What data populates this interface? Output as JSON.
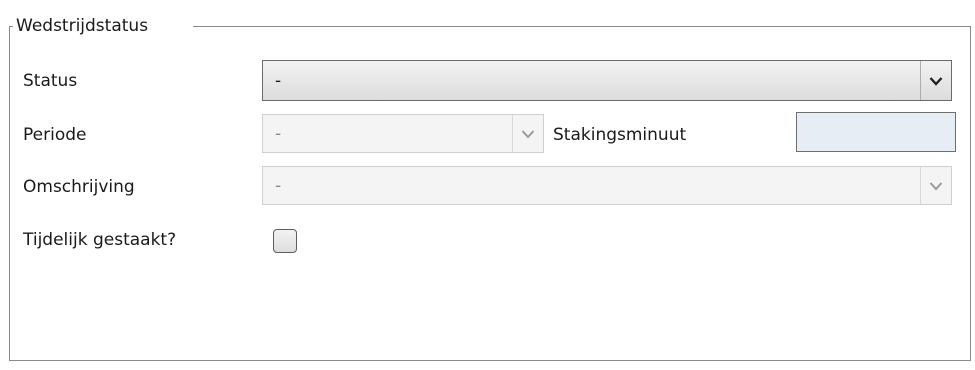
{
  "group": {
    "title": "Wedstrijdstatus"
  },
  "status": {
    "label": "Status",
    "value": "-"
  },
  "periode": {
    "label": "Periode",
    "value": "-"
  },
  "stakingsminuut": {
    "label": "Stakingsminuut",
    "value": ""
  },
  "omschrijving": {
    "label": "Omschrijving",
    "value": "-"
  },
  "tijdelijk": {
    "label": "Tijdelijk gestaakt?",
    "checked": false
  },
  "icons": {
    "dropdown": "chevron-down-icon"
  },
  "colors": {
    "frame": "#8a8a8a",
    "textbox_bg": "#e6edf5"
  }
}
